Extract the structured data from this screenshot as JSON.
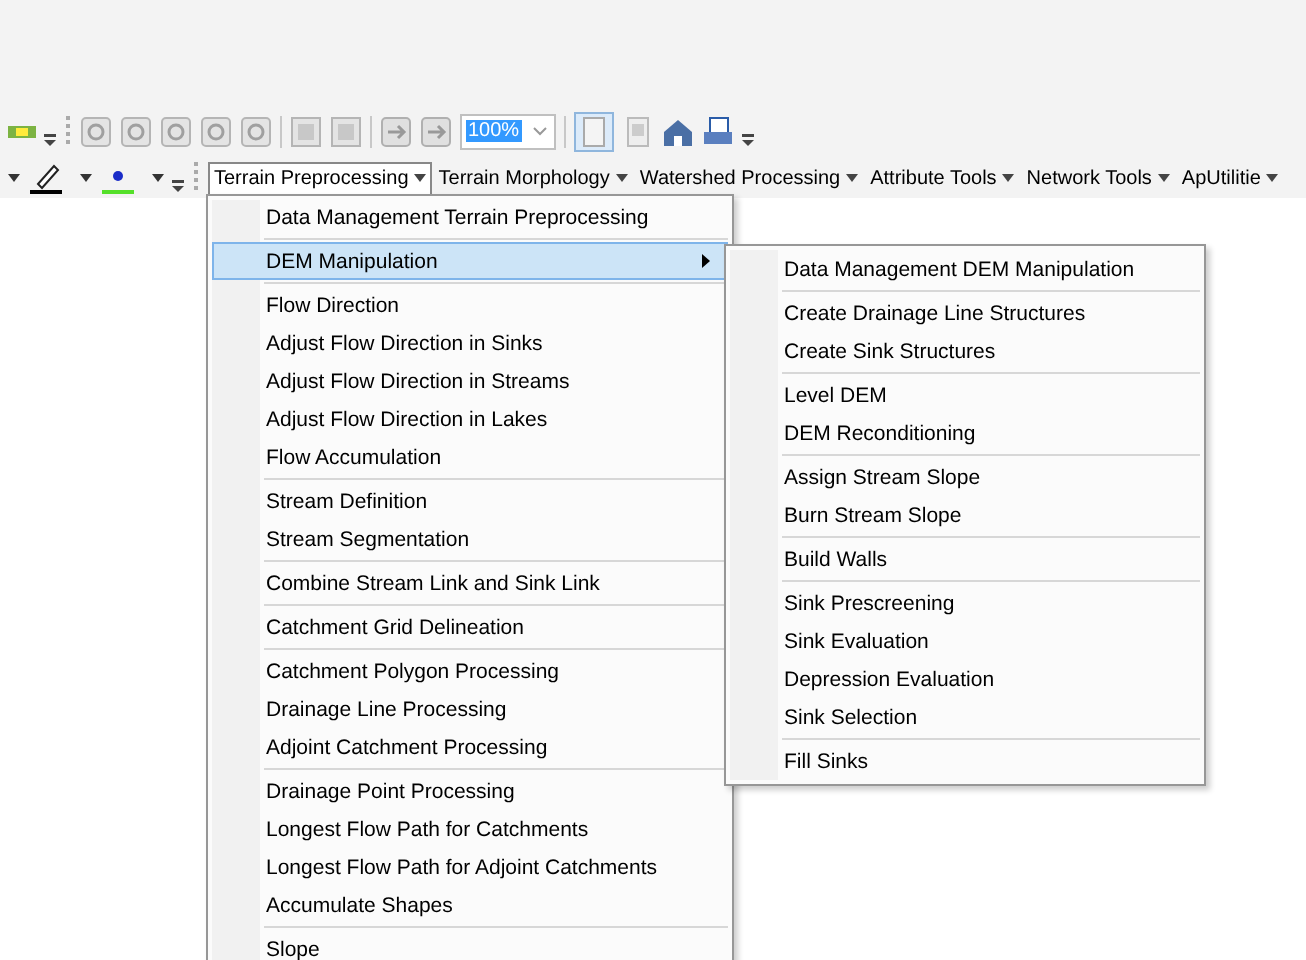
{
  "toolbar": {
    "zoom_value": "100%"
  },
  "menu_bar": [
    {
      "label": "Terrain Preprocessing",
      "selected": true
    },
    {
      "label": "Terrain Morphology",
      "selected": false
    },
    {
      "label": "Watershed Processing",
      "selected": false
    },
    {
      "label": "Attribute Tools",
      "selected": false
    },
    {
      "label": "Network Tools",
      "selected": false
    },
    {
      "label": "ApUtilitie",
      "selected": false
    }
  ],
  "dropdown": {
    "groups": [
      [
        {
          "label": "Data Management Terrain Preprocessing",
          "selected": false,
          "submenu": false
        }
      ],
      [
        {
          "label": "DEM Manipulation",
          "selected": true,
          "submenu": true
        }
      ],
      [
        {
          "label": "Flow Direction",
          "selected": false,
          "submenu": false
        },
        {
          "label": "Adjust Flow Direction in Sinks",
          "selected": false,
          "submenu": false
        },
        {
          "label": "Adjust Flow Direction in Streams",
          "selected": false,
          "submenu": false
        },
        {
          "label": "Adjust Flow Direction in Lakes",
          "selected": false,
          "submenu": false
        },
        {
          "label": "Flow Accumulation",
          "selected": false,
          "submenu": false
        }
      ],
      [
        {
          "label": "Stream Definition",
          "selected": false,
          "submenu": false
        },
        {
          "label": "Stream Segmentation",
          "selected": false,
          "submenu": false
        }
      ],
      [
        {
          "label": "Combine Stream Link and Sink Link",
          "selected": false,
          "submenu": false
        }
      ],
      [
        {
          "label": "Catchment Grid Delineation",
          "selected": false,
          "submenu": false
        }
      ],
      [
        {
          "label": "Catchment Polygon Processing",
          "selected": false,
          "submenu": false
        },
        {
          "label": "Drainage Line Processing",
          "selected": false,
          "submenu": false
        },
        {
          "label": "Adjoint Catchment Processing",
          "selected": false,
          "submenu": false
        }
      ],
      [
        {
          "label": "Drainage Point Processing",
          "selected": false,
          "submenu": false
        },
        {
          "label": "Longest Flow Path for Catchments",
          "selected": false,
          "submenu": false
        },
        {
          "label": "Longest Flow Path for Adjoint Catchments",
          "selected": false,
          "submenu": false
        },
        {
          "label": "Accumulate Shapes",
          "selected": false,
          "submenu": false
        }
      ],
      [
        {
          "label": "Slope",
          "selected": false,
          "submenu": false
        }
      ]
    ]
  },
  "submenu": {
    "groups": [
      [
        "Data Management DEM Manipulation"
      ],
      [
        "Create Drainage Line Structures",
        "Create Sink Structures"
      ],
      [
        "Level DEM",
        "DEM Reconditioning"
      ],
      [
        "Assign Stream Slope",
        "Burn Stream Slope"
      ],
      [
        "Build Walls"
      ],
      [
        "Sink Prescreening",
        "Sink Evaluation",
        "Depression Evaluation",
        "Sink Selection"
      ],
      [
        "Fill Sinks"
      ]
    ]
  }
}
